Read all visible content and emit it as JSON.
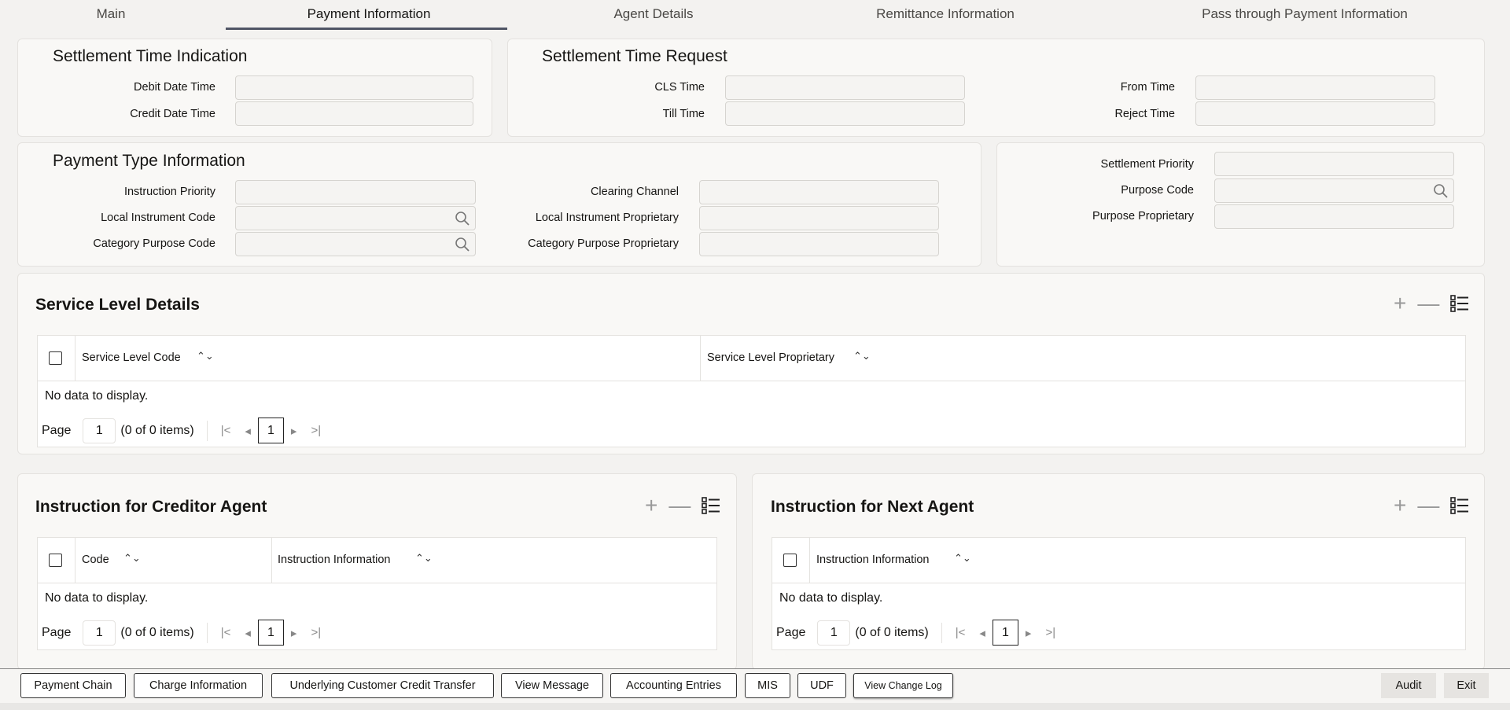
{
  "tabs": [
    {
      "label": "Main"
    },
    {
      "label": "Payment Information"
    },
    {
      "label": "Agent Details"
    },
    {
      "label": "Remittance Information"
    },
    {
      "label": "Pass through Payment Information"
    }
  ],
  "settlement_time_indication": {
    "title": "Settlement Time Indication",
    "debit_label": "Debit Date Time",
    "credit_label": "Credit Date Time"
  },
  "settlement_time_request": {
    "title": "Settlement Time Request",
    "cls_label": "CLS Time",
    "till_label": "Till Time",
    "from_label": "From Time",
    "reject_label": "Reject Time"
  },
  "payment_type": {
    "title": "Payment Type Information",
    "instruction_priority": "Instruction Priority",
    "local_instrument_code": "Local Instrument Code",
    "category_purpose_code": "Category Purpose Code",
    "clearing_channel": "Clearing Channel",
    "local_instrument_proprietary": "Local Instrument Proprietary",
    "category_purpose_proprietary": "Category Purpose Proprietary"
  },
  "purpose": {
    "settlement_priority": "Settlement Priority",
    "purpose_code": "Purpose Code",
    "purpose_proprietary": "Purpose Proprietary"
  },
  "pagination": {
    "page_label": "Page",
    "page_value": "1",
    "items": "(0 of 0 items)",
    "current": "1"
  },
  "no_data": "No data to display.",
  "service_level": {
    "title": "Service Level Details",
    "columns": [
      "Service Level Code",
      "Service Level Proprietary"
    ]
  },
  "creditor_agent": {
    "title": "Instruction for Creditor Agent",
    "columns": [
      "Code",
      "Instruction Information"
    ]
  },
  "next_agent": {
    "title": "Instruction for Next Agent",
    "columns": [
      "Instruction Information"
    ]
  },
  "footer": {
    "buttons": [
      "Payment Chain",
      "Charge Information",
      "Underlying Customer Credit Transfer",
      "View Message",
      "Accounting Entries",
      "MIS",
      "UDF",
      "View Change Log"
    ],
    "audit": "Audit",
    "exit": "Exit"
  }
}
